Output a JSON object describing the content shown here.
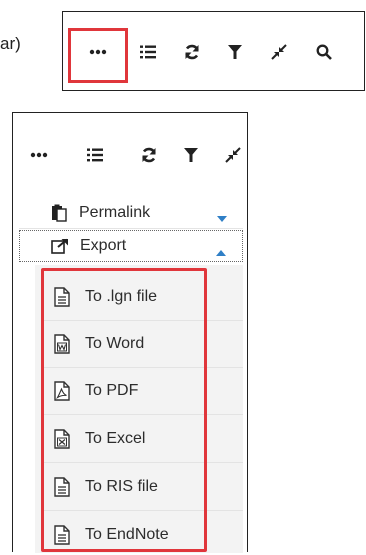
{
  "caption": {
    "fragment": "ar)"
  },
  "toolbar": {
    "buttons": [
      {
        "name": "more",
        "icon": "ellipsis-icon"
      },
      {
        "name": "list",
        "icon": "list-icon"
      },
      {
        "name": "refresh",
        "icon": "refresh-icon"
      },
      {
        "name": "filter",
        "icon": "filter-icon"
      },
      {
        "name": "collapse",
        "icon": "compress-icon"
      },
      {
        "name": "search",
        "icon": "search-icon"
      }
    ]
  },
  "menu": {
    "permalink": {
      "label": "Permalink",
      "icon": "clipboard-icon",
      "caret": "caret-down-icon"
    },
    "export": {
      "label": "Export",
      "icon": "external-link-icon",
      "caret": "caret-up-icon"
    },
    "export_items": [
      {
        "label": "To .lgn file",
        "icon": "document-icon"
      },
      {
        "label": "To Word",
        "icon": "word-document-icon"
      },
      {
        "label": "To PDF",
        "icon": "pdf-document-icon"
      },
      {
        "label": "To Excel",
        "icon": "excel-document-icon"
      },
      {
        "label": "To RIS file",
        "icon": "document-icon"
      },
      {
        "label": "To EndNote",
        "icon": "document-icon"
      }
    ]
  },
  "colors": {
    "highlight": "#e0363b",
    "caret": "#2f7fc6",
    "text": "#2c2c2c"
  }
}
